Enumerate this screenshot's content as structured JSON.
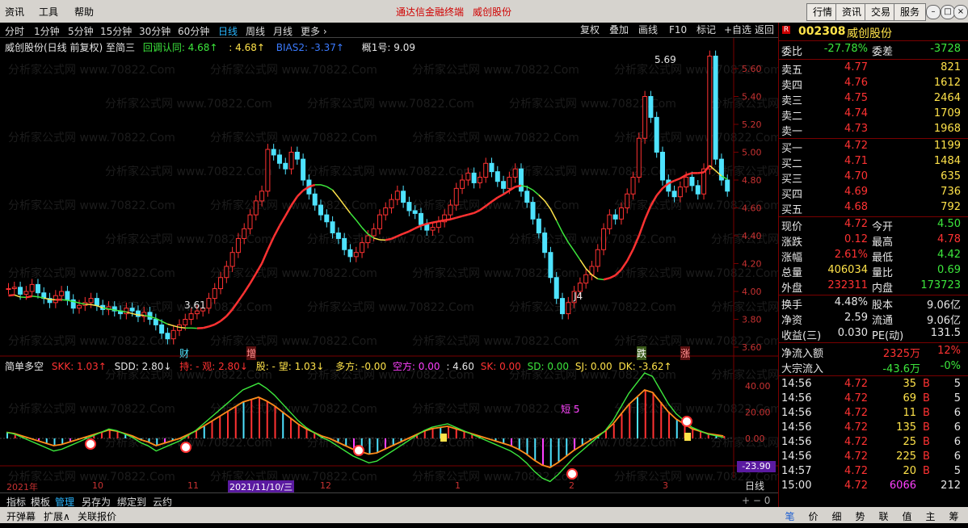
{
  "menu": {
    "items": [
      "资讯",
      "工具",
      "帮助"
    ],
    "title_app": "通达信金融终端",
    "title_stock": "威创股份"
  },
  "sys_buttons": [
    "行情",
    "资讯",
    "交易",
    "服务"
  ],
  "periods": [
    "分时",
    "1分钟",
    "5分钟",
    "15分钟",
    "30分钟",
    "60分钟",
    "日线",
    "周线",
    "月线",
    "更多 ›"
  ],
  "active_period": "日线",
  "toolbar": [
    "复权",
    "叠加",
    "画线",
    "F10",
    "标记",
    "+自选",
    "返回"
  ],
  "main_chart": {
    "legend_name": "威创股份(日线 前复权) 至简三",
    "legend_items": [
      {
        "text": "回调认同: 4.68↑",
        "color": "#3ce63c"
      },
      {
        "text": ": 4.68↑",
        "color": "#ffe34a"
      },
      {
        "text": "BIAS2: -3.37↑",
        "color": "#3b7bff"
      },
      {
        "text": "概1号: 9.09",
        "color": "#e6e6e6"
      }
    ],
    "price_axis": [
      "5.60",
      "5.40",
      "5.20",
      "5.00",
      "4.80",
      "4.60",
      "4.40",
      "4.20",
      "4.00",
      "3.80",
      "3.60"
    ],
    "annotations": {
      "high": "5.69",
      "low": "3.61",
      "j4": "J4"
    },
    "markers": [
      {
        "text": "财",
        "color": "#4ee3ff"
      },
      {
        "text": "增",
        "color": "#ff9090"
      },
      {
        "text": "跌",
        "color": "#ffffff"
      },
      {
        "text": "涨",
        "color": "#ff9090"
      }
    ]
  },
  "sub_chart": {
    "legend_name": "简单多空",
    "legend_items": [
      {
        "text": "SKK: 1.03↑",
        "color": "#ff3232"
      },
      {
        "text": "SDD: 2.80↓",
        "color": "#e6e6e6"
      },
      {
        "text": "持: - 观: 2.80↓",
        "color": "#ff3232"
      },
      {
        "text": "股: - 望: 1.03↓",
        "color": "#ffe34a"
      },
      {
        "text": "多方: -0.00",
        "color": "#ffe34a"
      },
      {
        "text": "空方: 0.00",
        "color": "#ff40ff"
      },
      {
        "text": ": 4.60",
        "color": "#e6e6e6"
      },
      {
        "text": "SK: 0.00",
        "color": "#ff3232"
      },
      {
        "text": "SD: 0.00",
        "color": "#3ce63c"
      },
      {
        "text": "SJ: 0.00",
        "color": "#ffe34a"
      },
      {
        "text": "DK: -3.62↑",
        "color": "#ffe34a"
      }
    ],
    "axis": [
      "40.00",
      "20.00",
      "0.00"
    ],
    "current_value": "-23.90",
    "label_5": "短 5"
  },
  "time_axis": [
    "2021年",
    "10",
    "11",
    "2021/11/10/三",
    "12",
    "1",
    "2",
    "3"
  ],
  "period_label": "日线",
  "bottom_tabs": [
    "指标",
    "模板",
    "管理",
    "另存为",
    "绑定到",
    "云约"
  ],
  "bottom_tabs2": [
    "开弹幕",
    "扩展∧",
    "关联报价"
  ],
  "right": {
    "code": "002308",
    "name": "威创股份",
    "weibi_label": "委比",
    "weibi": "-27.78%",
    "weicha_label": "委差",
    "weicha": "-3728",
    "asks": [
      {
        "label": "卖五",
        "price": "4.77",
        "vol": "821"
      },
      {
        "label": "卖四",
        "price": "4.76",
        "vol": "1612"
      },
      {
        "label": "卖三",
        "price": "4.75",
        "vol": "2464"
      },
      {
        "label": "卖二",
        "price": "4.74",
        "vol": "1709"
      },
      {
        "label": "卖一",
        "price": "4.73",
        "vol": "1968"
      }
    ],
    "bids": [
      {
        "label": "买一",
        "price": "4.72",
        "vol": "1199"
      },
      {
        "label": "买二",
        "price": "4.71",
        "vol": "1484"
      },
      {
        "label": "买三",
        "price": "4.70",
        "vol": "635"
      },
      {
        "label": "买四",
        "price": "4.69",
        "vol": "736"
      },
      {
        "label": "买五",
        "price": "4.68",
        "vol": "792"
      }
    ],
    "stats": [
      {
        "l1": "现价",
        "v1": "4.72",
        "c1": "#ff3232",
        "l2": "今开",
        "v2": "4.50",
        "c2": "#3ce63c"
      },
      {
        "l1": "涨跌",
        "v1": "0.12",
        "c1": "#ff3232",
        "l2": "最高",
        "v2": "4.78",
        "c2": "#ff3232"
      },
      {
        "l1": "涨幅",
        "v1": "2.61%",
        "c1": "#ff3232",
        "l2": "最低",
        "v2": "4.42",
        "c2": "#3ce63c"
      },
      {
        "l1": "总量",
        "v1": "406034",
        "c1": "#ffe34a",
        "l2": "量比",
        "v2": "0.69",
        "c2": "#3ce63c"
      },
      {
        "l1": "外盘",
        "v1": "232311",
        "c1": "#ff3232",
        "l2": "内盘",
        "v2": "173723",
        "c2": "#3ce63c"
      }
    ],
    "stats2": [
      {
        "l1": "换手",
        "v1": "4.48%",
        "c1": "#e6e6e6",
        "l2": "股本",
        "v2": "9.06亿",
        "c2": "#e6e6e6"
      },
      {
        "l1": "净资",
        "v1": "2.59",
        "c1": "#e6e6e6",
        "l2": "流通",
        "v2": "9.06亿",
        "c2": "#e6e6e6"
      },
      {
        "l1": "收益(三)",
        "v1": "0.030",
        "c1": "#e6e6e6",
        "l2": "PE(动)",
        "v2": "131.5",
        "c2": "#e6e6e6"
      }
    ],
    "flow": [
      {
        "label": "净流入额",
        "v1": "2325万",
        "v2": "12%",
        "c": "#ff3232"
      },
      {
        "label": "大宗流入",
        "v1": "-43.6万",
        "v2": "-0%",
        "c": "#3ce63c"
      }
    ],
    "ticks": [
      {
        "time": "14:56",
        "price": "4.72",
        "vol": "35",
        "bs": "B",
        "n": "5"
      },
      {
        "time": "14:56",
        "price": "4.72",
        "vol": "69",
        "bs": "B",
        "n": "5"
      },
      {
        "time": "14:56",
        "price": "4.72",
        "vol": "11",
        "bs": "B",
        "n": "6"
      },
      {
        "time": "14:56",
        "price": "4.72",
        "vol": "135",
        "bs": "B",
        "n": "6"
      },
      {
        "time": "14:56",
        "price": "4.72",
        "vol": "25",
        "bs": "B",
        "n": "6"
      },
      {
        "time": "14:56",
        "price": "4.72",
        "vol": "225",
        "bs": "B",
        "n": "6"
      },
      {
        "time": "14:57",
        "price": "4.72",
        "vol": "20",
        "bs": "B",
        "n": "5"
      },
      {
        "time": "15:00",
        "price": "4.72",
        "vol": "6066",
        "bs": "",
        "n": "212"
      }
    ],
    "bottom_tabs": [
      "笔",
      "价",
      "细",
      "势",
      "联",
      "值",
      "主",
      "筹"
    ]
  }
}
